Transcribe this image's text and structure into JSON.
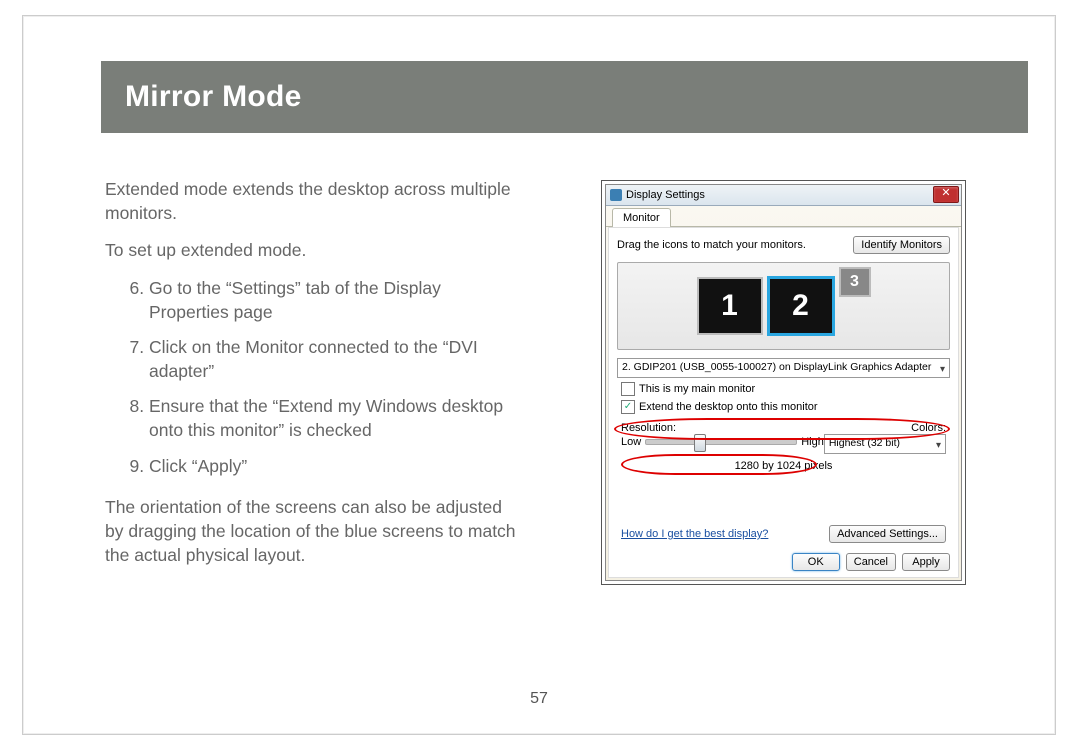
{
  "header": {
    "title": "Mirror Mode"
  },
  "body": {
    "intro": "Extended mode extends the desktop across multiple monitors.",
    "setup_line": "To set up extended mode.",
    "steps": {
      "s6": "Go to the “Settings” tab of the Display Properties page",
      "s7": "Click on the Monitor connected to the “DVI adapter”",
      "s8": "Ensure that the “Extend my Windows desktop onto this monitor” is checked",
      "s9": "Click “Apply”"
    },
    "outro": "The orientation of the screens can also be adjusted by dragging the location of the blue screens to match the actual physical layout."
  },
  "page_number": "57",
  "screenshot": {
    "title": "Display Settings",
    "tab": "Monitor",
    "drag_text": "Drag the icons to match your monitors.",
    "identify_btn": "Identify Monitors",
    "monitors": {
      "m1": "1",
      "m2": "2",
      "m3": "3"
    },
    "monitor_dropdown": "2. GDIP201 (USB_0055-100027) on DisplayLink Graphics Adapter",
    "chk_main": "This is my main monitor",
    "chk_extend": "Extend the desktop onto this monitor",
    "chk_extend_checked": "✓",
    "res_label": "Resolution:",
    "colors_label": "Colors:",
    "low": "Low",
    "high": "High",
    "res_value": "1280 by 1024 pixels",
    "colors_value": "Highest (32 bit)",
    "help_link": "How do I get the best display?",
    "adv_btn": "Advanced Settings...",
    "ok": "OK",
    "cancel": "Cancel",
    "apply": "Apply",
    "close_x": "✕"
  }
}
